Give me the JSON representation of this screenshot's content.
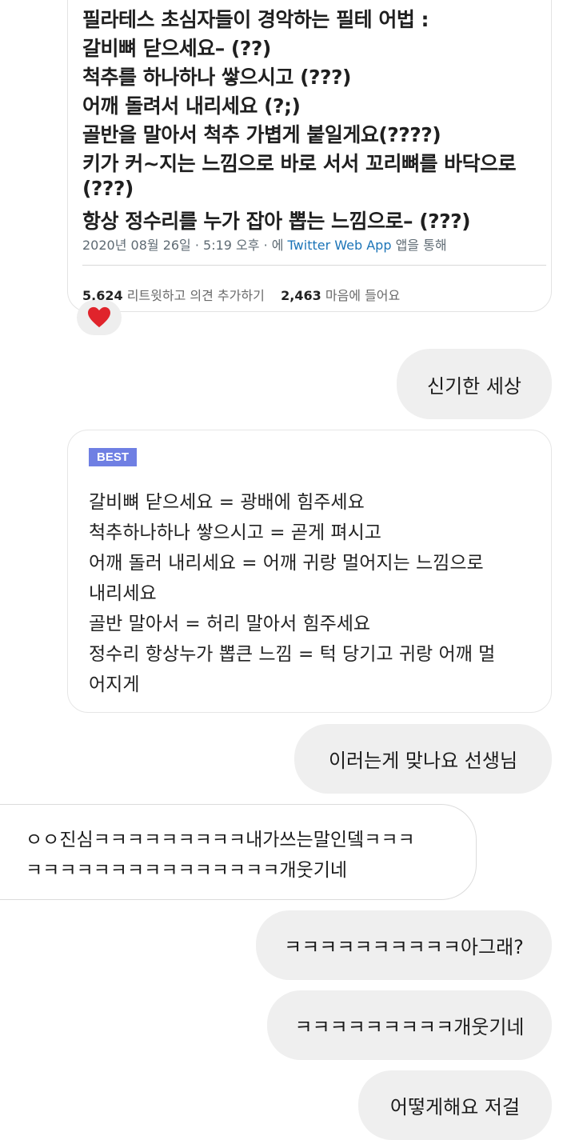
{
  "tweet": {
    "lines": [
      "필라테스 초심자들이 경악하는 필테 어법 :",
      "갈비뼈 닫으세요– (??)",
      "척추를 하나하나 쌓으시고 (???)",
      "어깨 돌려서 내리세요 (?;)",
      "골반을 말아서 척추 가볍게 붙일게요(????)",
      "키가 커~지는 느낌으로 바로 서서 꼬리뼈를 바닥으로",
      "(???)",
      "항상 정수리를 누가 잡아 뽑는 느낌으로– (???)"
    ],
    "meta_prefix": "2020년 08월 26일 · 5:19 오후 · 에 ",
    "meta_link": "Twitter Web App",
    "meta_suffix": " 앱을 통해",
    "retweets_count": "5,624",
    "retweets_label": "리트윗하고 의견 추가하기",
    "likes_count": "2,463",
    "likes_label": "마음에 들어요"
  },
  "reaction": {
    "emoji": "❤️",
    "icon": "heart-icon",
    "color": "#e0242c"
  },
  "messages": {
    "m1": "신기한 세상",
    "m3": "이러는게 맞나요 선생님",
    "m4_line1": "ㅇㅇ진심ㅋㅋㅋㅋㅋㅋㅋㅋㅋ내가쓰는말인뎈ㅋㅋㅋ",
    "m4_line2": "ㅋㅋㅋㅋㅋㅋㅋㅋㅋㅋㅋㅋㅋㅋㅋ개웃기네",
    "m5": "ㅋㅋㅋㅋㅋㅋㅋㅋㅋㅋ아그래?",
    "m6": "ㅋㅋㅋㅋㅋㅋㅋㅋㅋ개웃기네",
    "m7": "어떻게해요 저걸"
  },
  "best_reply": {
    "badge": "BEST",
    "badge_color": "#6f7fe3",
    "lines": [
      "갈비뼈 닫으세요 = 광배에 힘주세요",
      "척추하나하나 쌓으시고 = 곧게 펴시고",
      "어깨 돌러 내리세요 = 어깨 귀랑 멀어지는 느낌으로",
      "내리세요",
      "골반 말아서 = 허리 말아서 힘주세요",
      "정수리 항상누가 뽑큰 느낌 = 턱 당기고 귀랑 어깨 멀",
      "어지게"
    ]
  }
}
